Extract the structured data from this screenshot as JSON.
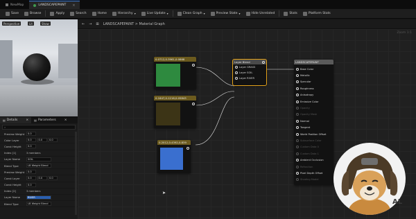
{
  "titlebar": {
    "tabs": [
      {
        "label": "NewMap",
        "active": false
      },
      {
        "label": "LANDSCAPEPAINT",
        "active": true
      }
    ]
  },
  "toolbar": {
    "items": [
      {
        "label": "Save",
        "icon": "save-icon"
      },
      {
        "label": "Browse",
        "icon": "browse-icon"
      },
      {
        "label": "Apply",
        "icon": "apply-icon"
      },
      {
        "label": "Search",
        "icon": "search-icon"
      },
      {
        "label": "Home",
        "icon": "home-icon"
      },
      {
        "label": "Hierarchy",
        "icon": "hierarchy-icon"
      },
      {
        "label": "Live Update",
        "icon": "live-update-icon"
      },
      {
        "label": "Clean Graph",
        "icon": "clean-graph-icon"
      },
      {
        "label": "Preview State",
        "icon": "preview-state-icon"
      },
      {
        "label": "Hide Unrelated",
        "icon": "hide-unrelated-icon"
      },
      {
        "label": "Stats",
        "icon": "stats-icon"
      },
      {
        "label": "Platform Stats",
        "icon": "platform-stats-icon"
      }
    ]
  },
  "viewport": {
    "buttons": [
      "Perspective",
      "Lit",
      "Show"
    ]
  },
  "details": {
    "tabs": [
      "Details",
      "Parameters"
    ],
    "rows": [
      {
        "label": "Preview Weight",
        "values": [
          "0.0"
        ]
      },
      {
        "label": "Color Layer",
        "values": [
          "0.0",
          "0.0",
          "0.0"
        ]
      },
      {
        "label": "Const Height",
        "values": [
          "0.0"
        ]
      },
      {
        "label": "Index [1]",
        "values": [
          "3 members"
        ]
      },
      {
        "label": "Layer Name",
        "values": [
          "SOIL"
        ]
      },
      {
        "label": "Blend Type",
        "values": [
          "LB Weight Blend"
        ]
      },
      {
        "label": "Preview Weight",
        "values": [
          "0.0"
        ]
      },
      {
        "label": "Const Layer",
        "values": [
          "0.0",
          "0.0",
          "0.0"
        ]
      },
      {
        "label": "Const Height",
        "values": [
          "0.0"
        ]
      },
      {
        "label": "Index [2]",
        "values": [
          "3 members"
        ]
      },
      {
        "label": "Layer Name",
        "values": [
          "RIVER"
        ]
      },
      {
        "label": "Blend Type",
        "values": [
          "LB Weight Blend"
        ]
      }
    ]
  },
  "graph": {
    "breadcrumb": "LANDSCAPEPAINT > Material Graph",
    "zoom": "Zoom 1:1",
    "nodes": {
      "green": {
        "title": "0.0712,0.3961,0.0868",
        "color": "#2e8a3f"
      },
      "brown": {
        "title": "0.1647,0.1216,0.05843",
        "color": "#3c3416"
      },
      "blue": {
        "title": "0.2012,0.4392,0.839",
        "color": "#3a6fcf"
      },
      "blend": {
        "title": "Layer Blend",
        "pins": [
          "Layer GRASS",
          "Layer SOIL",
          "Layer RIVER"
        ]
      },
      "material": {
        "title": "LANDSCAPEPAINT",
        "pins": [
          {
            "label": "Base Color",
            "enabled": true
          },
          {
            "label": "Metallic",
            "enabled": true
          },
          {
            "label": "Specular",
            "enabled": true
          },
          {
            "label": "Roughness",
            "enabled": true
          },
          {
            "label": "Anisotropy",
            "enabled": true
          },
          {
            "label": "Emissive Color",
            "enabled": true
          },
          {
            "label": "Opacity",
            "enabled": false
          },
          {
            "label": "Opacity Mask",
            "enabled": false
          },
          {
            "label": "Normal",
            "enabled": true
          },
          {
            "label": "Tangent",
            "enabled": true
          },
          {
            "label": "World Position Offset",
            "enabled": true
          },
          {
            "label": "Subsurface Color",
            "enabled": false
          },
          {
            "label": "Custom Data 0",
            "enabled": false
          },
          {
            "label": "Custom Data 1",
            "enabled": false
          },
          {
            "label": "Ambient Occlusion",
            "enabled": true
          },
          {
            "label": "Refraction",
            "enabled": false
          },
          {
            "label": "Pixel Depth Offset",
            "enabled": true
          },
          {
            "label": "Shading Model",
            "enabled": false
          }
        ]
      }
    }
  },
  "watermark": "AL"
}
